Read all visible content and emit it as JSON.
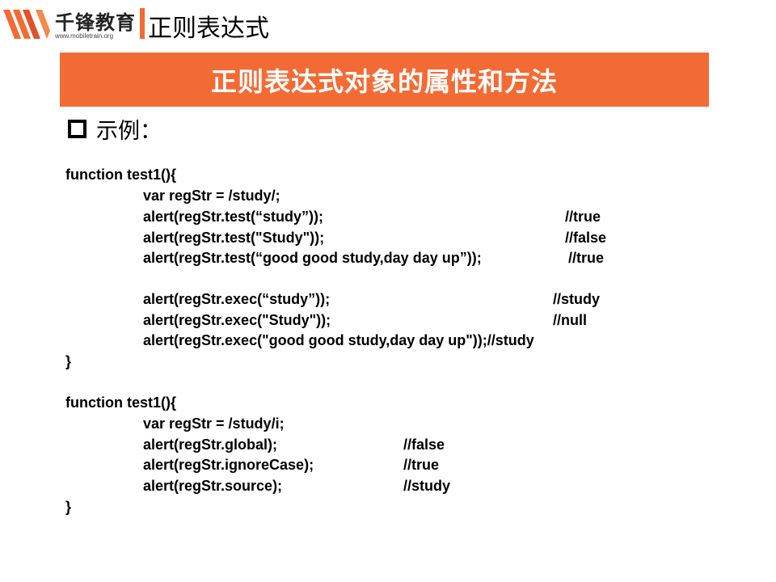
{
  "header": {
    "brand_name": "千锋教育",
    "brand_url": "www.mobiletrain.org",
    "section_title": "正则表达式"
  },
  "banner": {
    "title": "正则表达式对象的属性和方法"
  },
  "example": {
    "label": "示例："
  },
  "code": {
    "block1": {
      "open": "function test1(){",
      "lines": [
        {
          "code": "var regStr = /study/;",
          "comment": ""
        },
        {
          "code": "alert(regStr.test(“study”));",
          "comment": "//true"
        },
        {
          "code": "alert(regStr.test(\"Study\"));",
          "comment": "//false"
        },
        {
          "code": "alert(regStr.test(“good good study,day day up”));",
          "comment": "//true"
        },
        {
          "code": "alert(regStr.exec(“study”));",
          "comment": "//study"
        },
        {
          "code": "alert(regStr.exec(\"Study\"));",
          "comment": "//null"
        },
        {
          "code": "alert(regStr.exec(\"good good study,day day up\"));//study",
          "comment": ""
        }
      ],
      "close": "}"
    },
    "block2": {
      "open": "function test1(){",
      "lines": [
        {
          "code": "var regStr = /study/i;",
          "comment": ""
        },
        {
          "code": "alert(regStr.global);",
          "comment": "//false"
        },
        {
          "code": "alert(regStr.ignoreCase);",
          "comment": "//true"
        },
        {
          "code": "alert(regStr.source);",
          "comment": "//study"
        }
      ],
      "close": "}"
    }
  },
  "colors": {
    "accent": "#f26b35",
    "text": "#000000",
    "banner_text": "#ffffff"
  }
}
